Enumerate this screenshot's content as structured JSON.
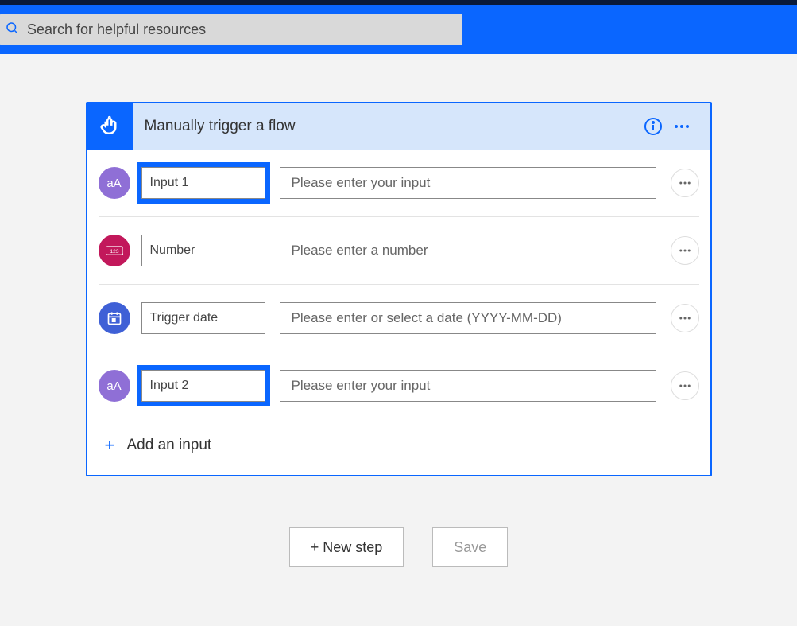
{
  "search": {
    "placeholder": "Search for helpful resources"
  },
  "card": {
    "title": "Manually trigger a flow",
    "addInputLabel": "Add an input"
  },
  "rows": [
    {
      "name": "Input 1",
      "placeholder": "Please enter your input",
      "iconClass": "ti-text",
      "iconGlyph": "aA",
      "highlight": true,
      "showCursor": true
    },
    {
      "name": "Number",
      "placeholder": "Please enter a number",
      "iconClass": "ti-number",
      "iconGlyph": "123",
      "highlight": false,
      "showCursor": false
    },
    {
      "name": "Trigger date",
      "placeholder": "Please enter or select a date (YYYY-MM-DD)",
      "iconClass": "ti-date",
      "iconGlyph": "cal",
      "highlight": false,
      "showCursor": false
    },
    {
      "name": "Input 2",
      "placeholder": "Please enter your input",
      "iconClass": "ti-text",
      "iconGlyph": "aA",
      "highlight": true,
      "showCursor": false
    }
  ],
  "footer": {
    "newStep": "+ New step",
    "save": "Save"
  }
}
